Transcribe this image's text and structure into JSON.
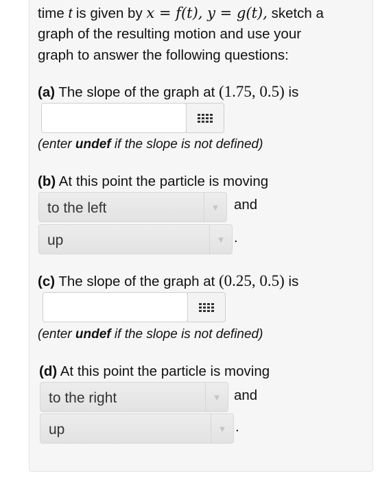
{
  "intro": {
    "line1_a": "time ",
    "line1_t": "t",
    "line1_b": " is given by ",
    "line1_math": "x = f(t), y = g(t),",
    "line1_c": " sketch a",
    "line2": "graph of the resulting motion and use your",
    "line3": "graph to answer the following questions:"
  },
  "part_a": {
    "tag": "(a)",
    "text": " The slope of the graph at ",
    "point": "(1.75, 0.5)",
    "suffix": " is",
    "answer_value": "",
    "note_prefix": "(enter ",
    "note_bold": "undef",
    "note_suffix": " if the slope is not defined)"
  },
  "part_b": {
    "tag": "(b)",
    "text": " At this point the particle is moving",
    "select1_value": "to the left",
    "and_label": "and",
    "select2_value": "up",
    "end_punct": "."
  },
  "part_c": {
    "tag": "(c)",
    "text": " The slope of the graph at ",
    "point": "(0.25, 0.5)",
    "suffix": " is",
    "answer_value": "",
    "note_prefix": "(enter ",
    "note_bold": "undef",
    "note_suffix": " if the slope is not defined)"
  },
  "part_d": {
    "tag": "(d)",
    "text": " At this point the particle is moving",
    "select1_value": "to the right",
    "and_label": "and",
    "select2_value": "up",
    "end_punct": "."
  },
  "icons": {
    "keyboard": "keyboard-grid-icon",
    "dropdown": "dropdown-arrow-icon",
    "dropdown_glyph": "▼"
  }
}
